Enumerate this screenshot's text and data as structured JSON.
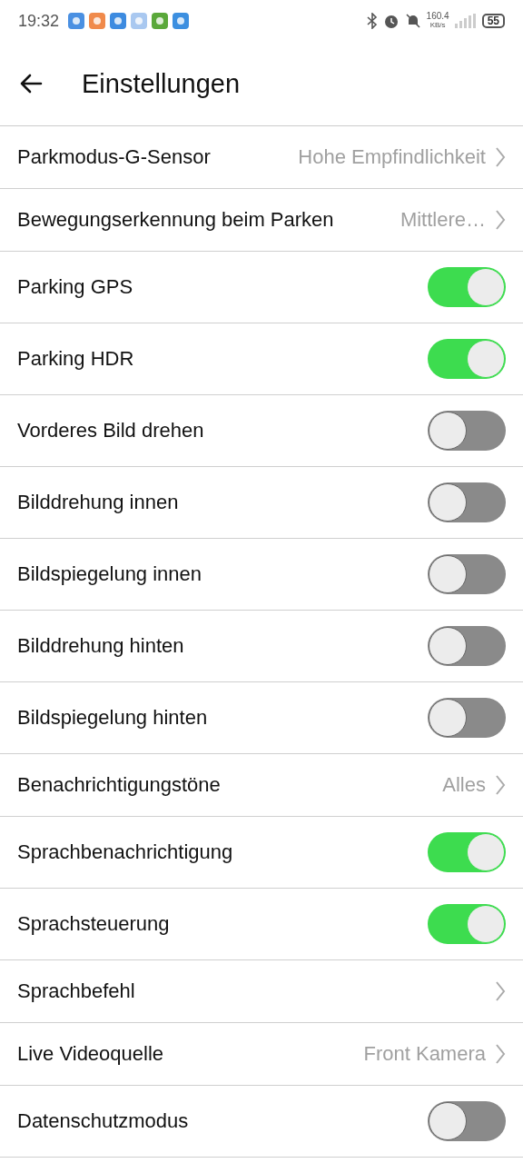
{
  "status_bar": {
    "time": "19:32",
    "speed_value": "160.4",
    "speed_unit": "KB/s",
    "battery": "55"
  },
  "header": {
    "title": "Einstellungen"
  },
  "settings": [
    {
      "kind": "select",
      "label": "Parkmodus-G-Sensor",
      "value": "Hohe Empfindlichkeit"
    },
    {
      "kind": "select",
      "label": "Bewegungserkennung beim Parken",
      "value": "Mittlere…"
    },
    {
      "kind": "toggle",
      "label": "Parking GPS",
      "on": true
    },
    {
      "kind": "toggle",
      "label": "Parking HDR",
      "on": true
    },
    {
      "kind": "toggle",
      "label": "Vorderes Bild drehen",
      "on": false
    },
    {
      "kind": "toggle",
      "label": "Bilddrehung innen",
      "on": false
    },
    {
      "kind": "toggle",
      "label": "Bildspiegelung innen",
      "on": false
    },
    {
      "kind": "toggle",
      "label": "Bilddrehung hinten",
      "on": false
    },
    {
      "kind": "toggle",
      "label": "Bildspiegelung hinten",
      "on": false
    },
    {
      "kind": "select",
      "label": "Benachrichtigungstöne",
      "value": "Alles"
    },
    {
      "kind": "toggle",
      "label": "Sprachbenachrichtigung",
      "on": true
    },
    {
      "kind": "toggle",
      "label": "Sprachsteuerung",
      "on": true
    },
    {
      "kind": "select",
      "label": "Sprachbefehl"
    },
    {
      "kind": "select",
      "label": "Live Videoquelle",
      "value": "Front Kamera"
    },
    {
      "kind": "toggle",
      "label": "Datenschutzmodus",
      "on": false
    }
  ]
}
